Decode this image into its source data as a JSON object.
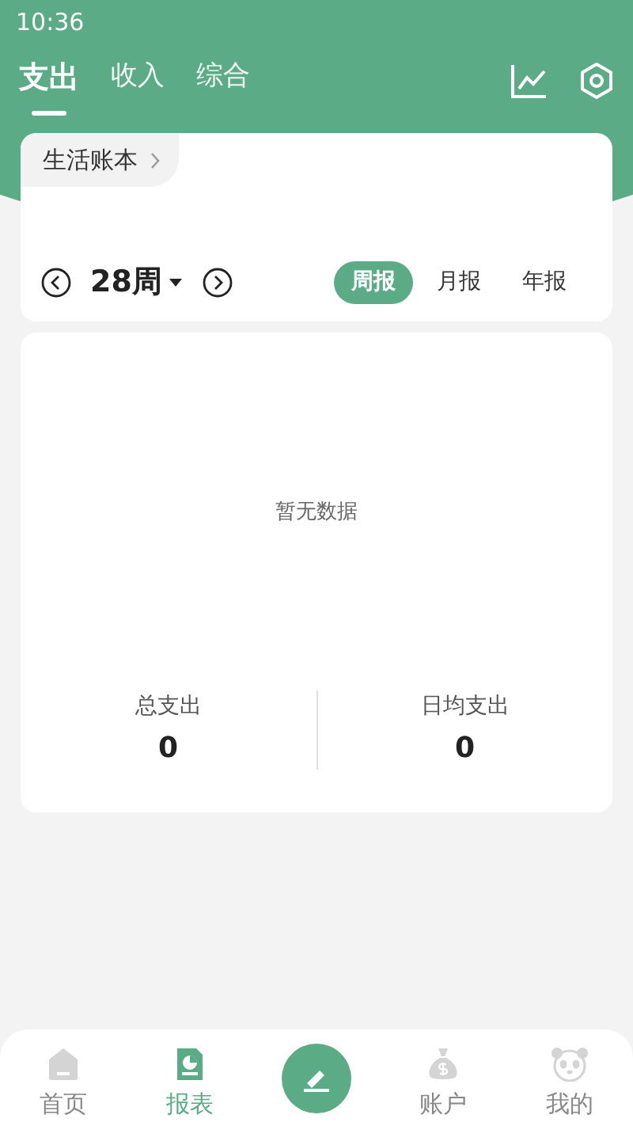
{
  "status_bar": {
    "time": "10:36"
  },
  "tabs": [
    {
      "label": "支出",
      "selected": true
    },
    {
      "label": "收入",
      "selected": false
    },
    {
      "label": "综合",
      "selected": false
    }
  ],
  "book": {
    "label": "生活账本"
  },
  "period": {
    "label": "28周"
  },
  "report_types": [
    {
      "label": "周报",
      "selected": true
    },
    {
      "label": "月报",
      "selected": false
    },
    {
      "label": "年报",
      "selected": false
    }
  ],
  "empty_message": "暂无数据",
  "summary": [
    {
      "label": "总支出",
      "value": "0"
    },
    {
      "label": "日均支出",
      "value": "0"
    }
  ],
  "bottom_nav": [
    {
      "kind": "home",
      "label": "首页",
      "selected": false
    },
    {
      "kind": "report",
      "label": "报表",
      "selected": true
    },
    {
      "kind": "add"
    },
    {
      "kind": "account",
      "label": "账户",
      "selected": false
    },
    {
      "kind": "mine",
      "label": "我的",
      "selected": false
    }
  ]
}
